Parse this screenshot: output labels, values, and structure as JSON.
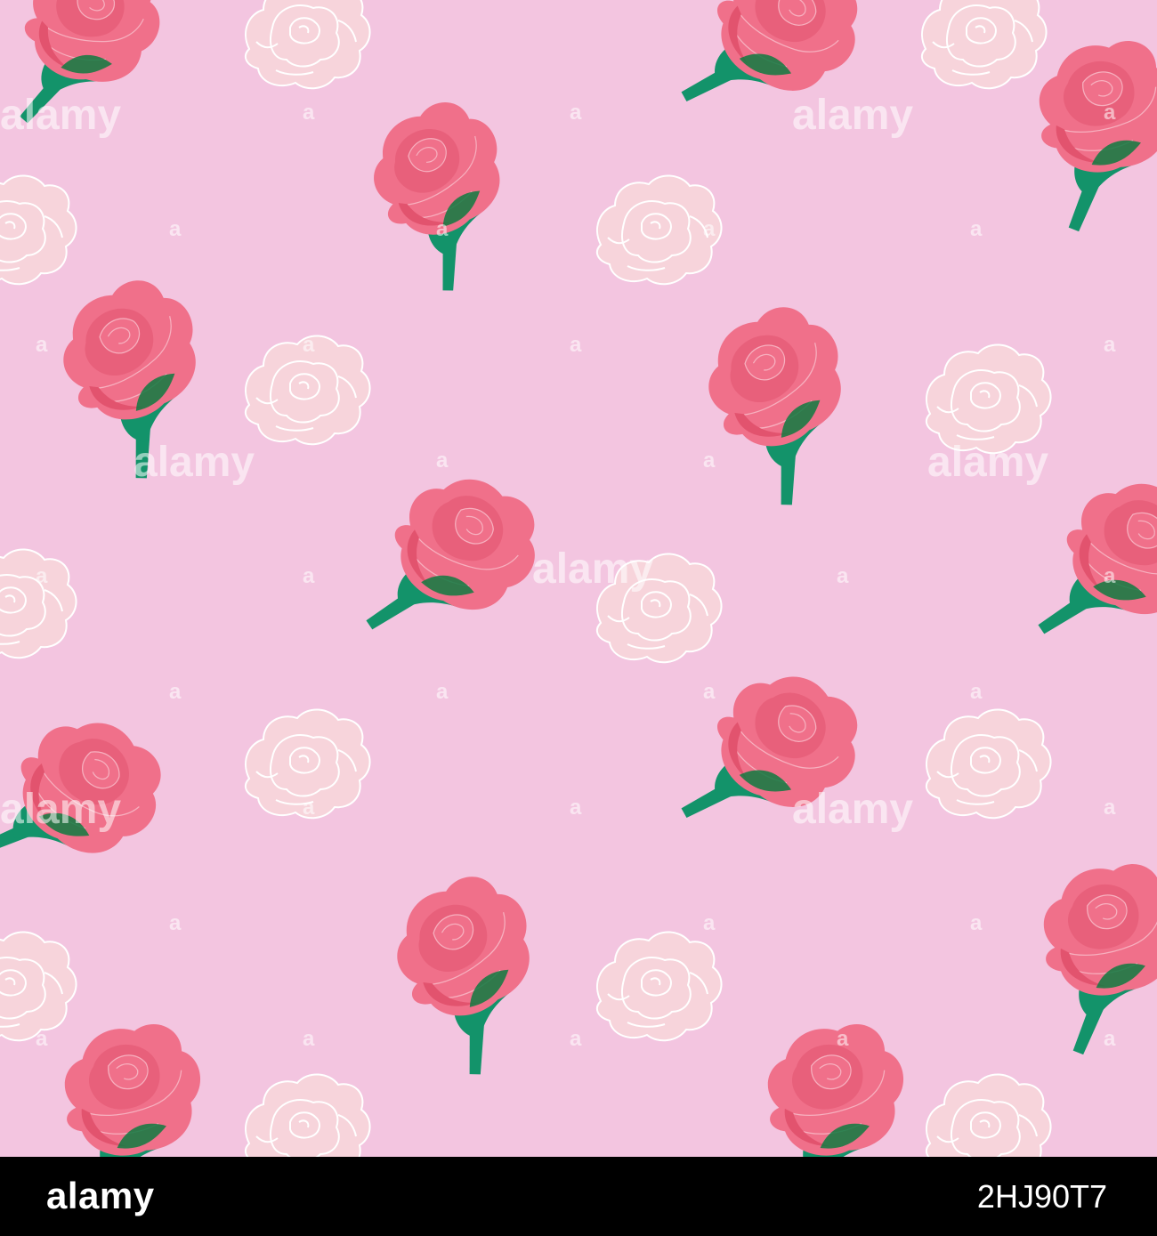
{
  "background_color": "#f3c5e0",
  "footer": {
    "logo_text": "alamy",
    "image_id": "2HJ90T7",
    "background_color": "#000000",
    "text_color": "#ffffff"
  },
  "watermark": {
    "text": "alamy",
    "short_text": "a",
    "color": "#ffffff"
  },
  "rose_colors": {
    "petal": "#f0708a",
    "petal_dark": "#e2536e",
    "petal_inner": "#e8607b",
    "leaf": "#13936a",
    "leaf_dark": "#0e7a40",
    "outline_rose_fill": "#f7d4db",
    "outline_rose_stroke": "#ffffff"
  }
}
